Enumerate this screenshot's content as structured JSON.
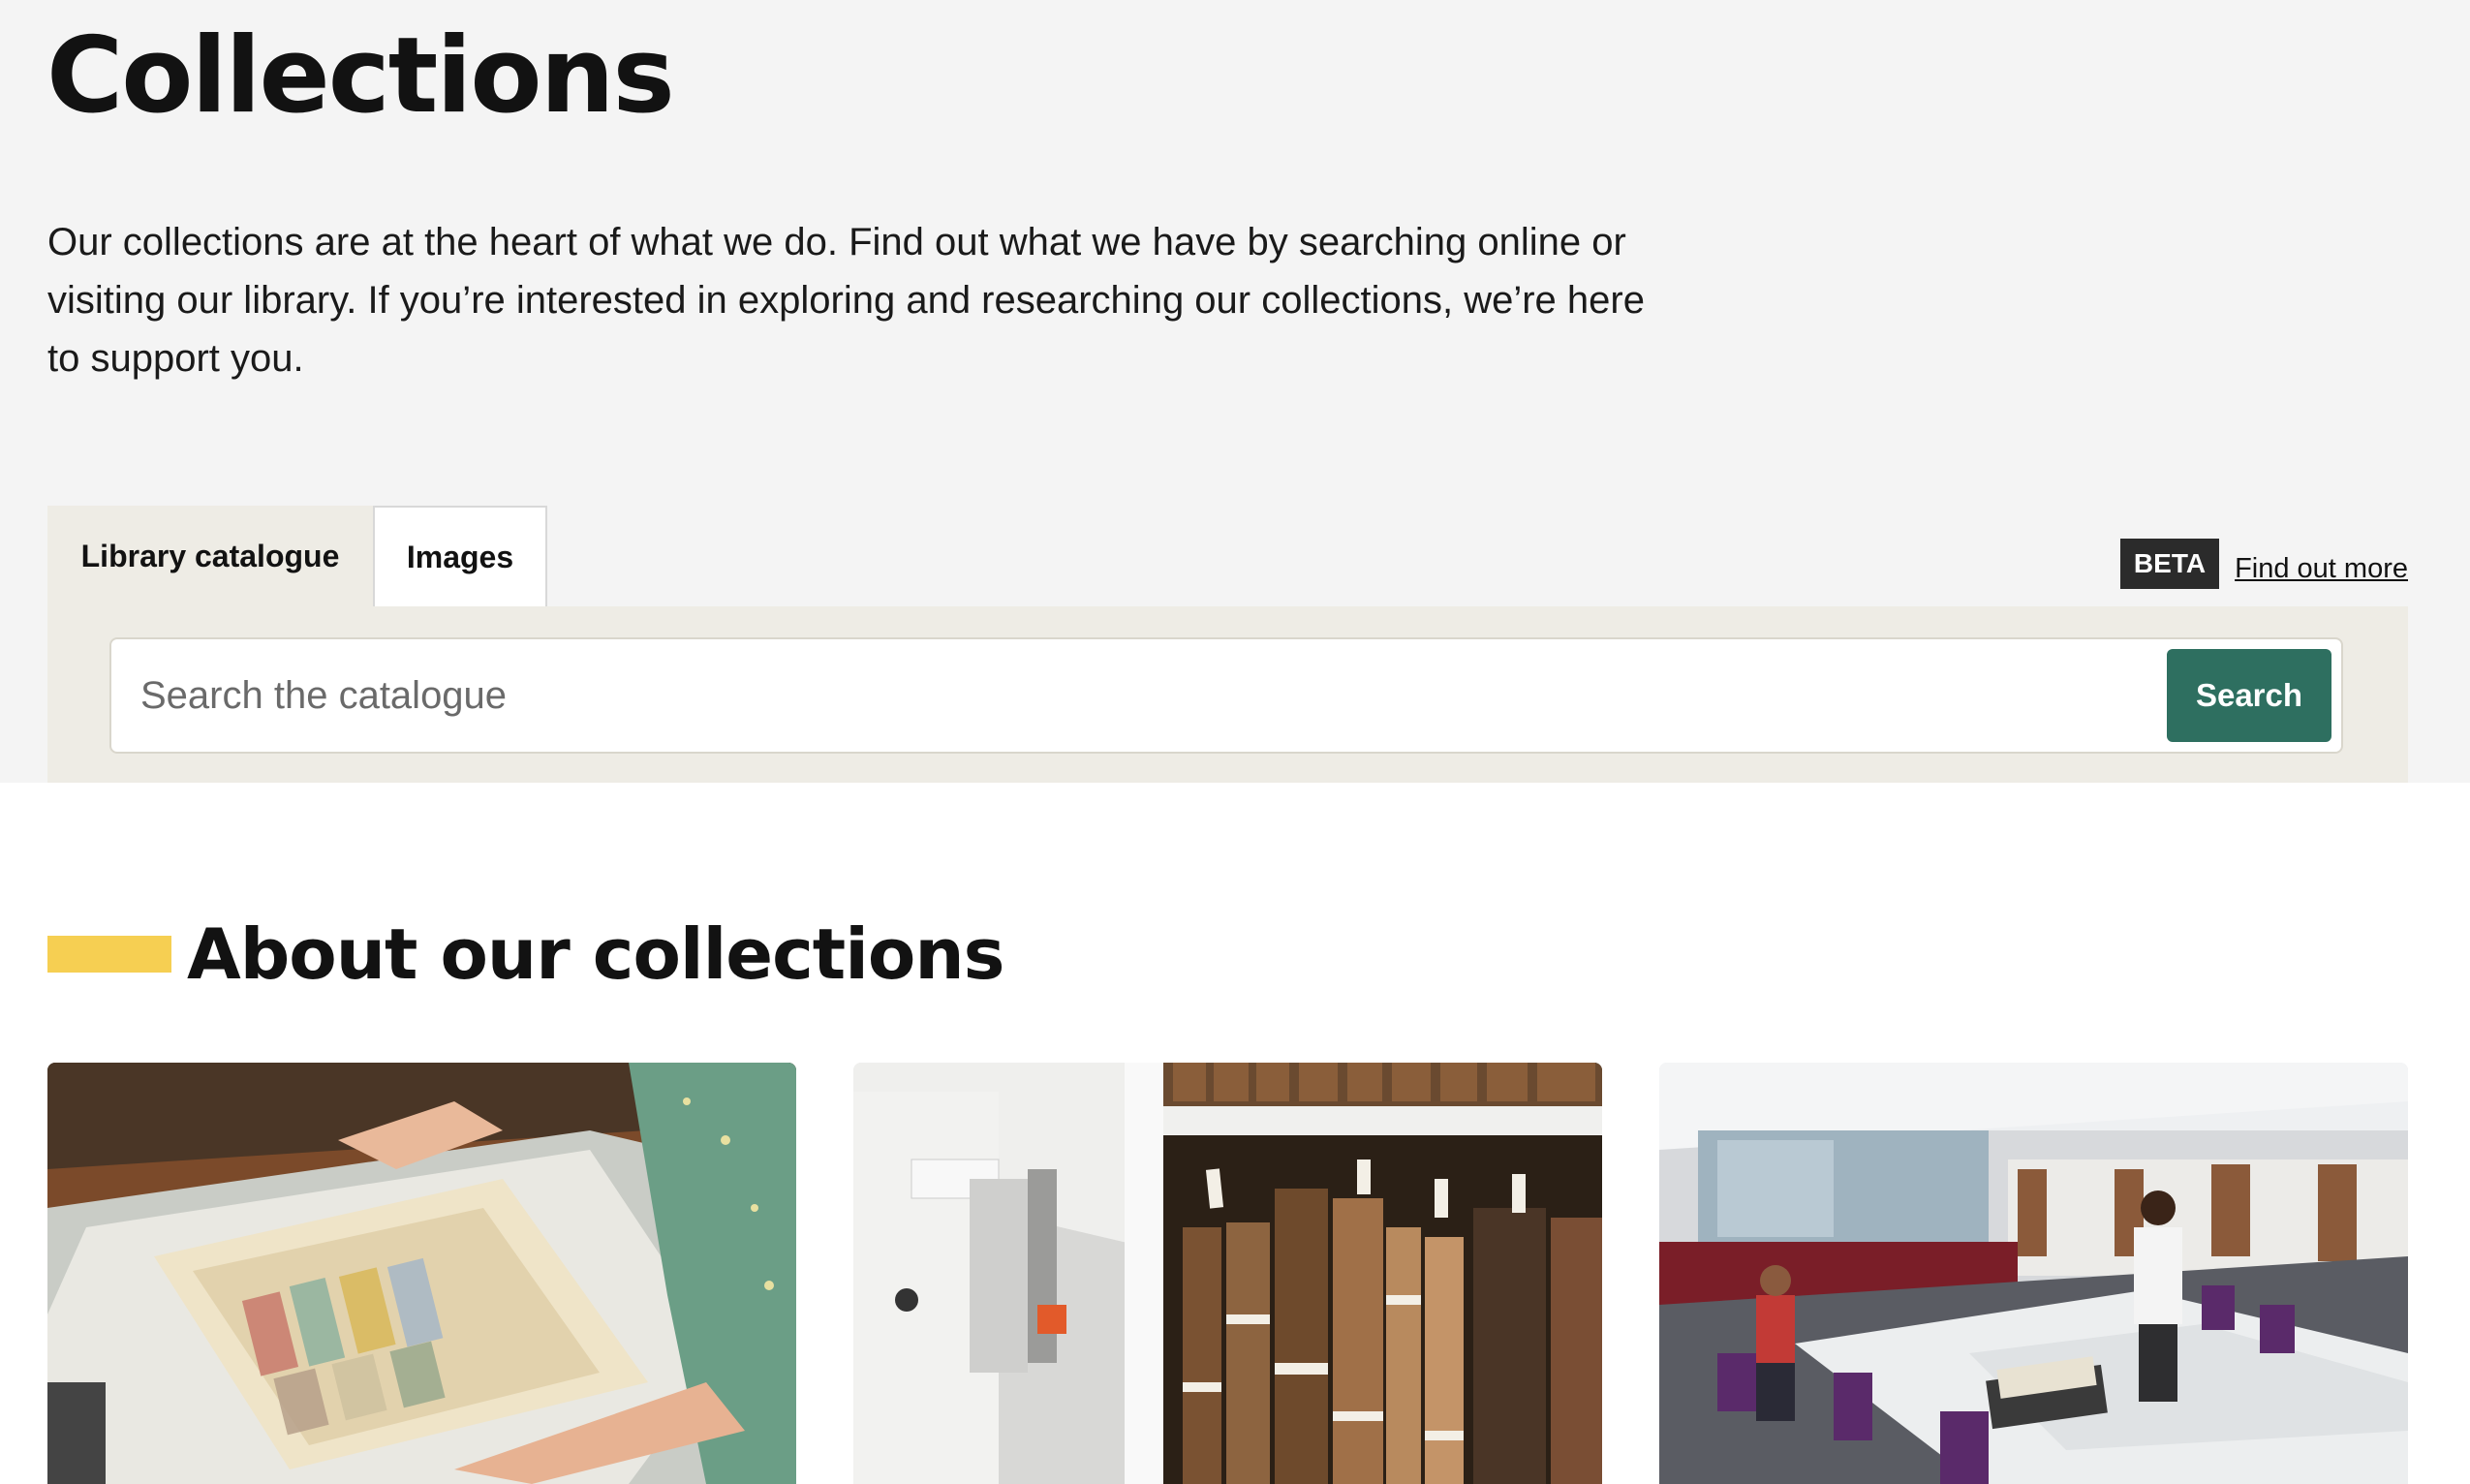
{
  "page": {
    "title": "Collections",
    "intro": "Our collections are at the heart of what we do. Find out what we have by searching online or visiting our library. If you’re interested in exploring and researching our collections, we’re here to support you."
  },
  "search": {
    "tabs": [
      {
        "label": "Library catalogue",
        "active": true
      },
      {
        "label": "Images",
        "active": false
      }
    ],
    "beta_label": "BETA",
    "find_out_more": "Find out more",
    "placeholder": "Search the catalogue",
    "value": "",
    "button_label": "Search"
  },
  "about": {
    "heading": "About our collections",
    "accent_color": "#f6cf52"
  },
  "cards": [
    {
      "image": "illuminated-manuscript-photo"
    },
    {
      "image": "rare-books-stacks-photo"
    },
    {
      "image": "library-reading-room-photo"
    }
  ],
  "colors": {
    "hero_bg": "#f4f4f4",
    "panel_bg": "#eeece5",
    "button": "#2e6f60",
    "beta_bg": "#2b2b2b"
  }
}
